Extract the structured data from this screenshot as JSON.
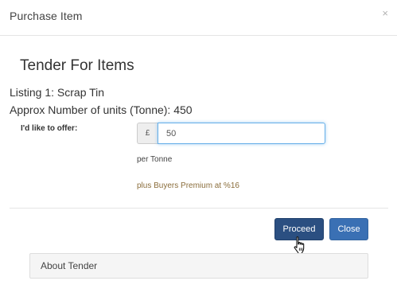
{
  "dialog": {
    "title": "Purchase Item",
    "close_glyph": "×"
  },
  "tender": {
    "heading": "Tender For Items",
    "listing": "Listing 1: Scrap Tin",
    "units": "Approx Number of units (Tonne): 450"
  },
  "offer": {
    "label": "I'd like to offer:",
    "currency_symbol": "£",
    "value": "50",
    "per_unit": "per Tonne",
    "premium_note": "plus Buyers Premium at %16"
  },
  "buttons": {
    "proceed_label": "Proceed",
    "close_label": "Close"
  },
  "about_panel": {
    "title": "About Tender"
  },
  "icons": {
    "close": "close-icon",
    "cursor": "hand-pointer-icon"
  },
  "colors": {
    "proceed_button": "#2b4f81",
    "close_button": "#3a70b4",
    "premium_text": "#8a6d3b",
    "input_focus": "#66afe9"
  }
}
